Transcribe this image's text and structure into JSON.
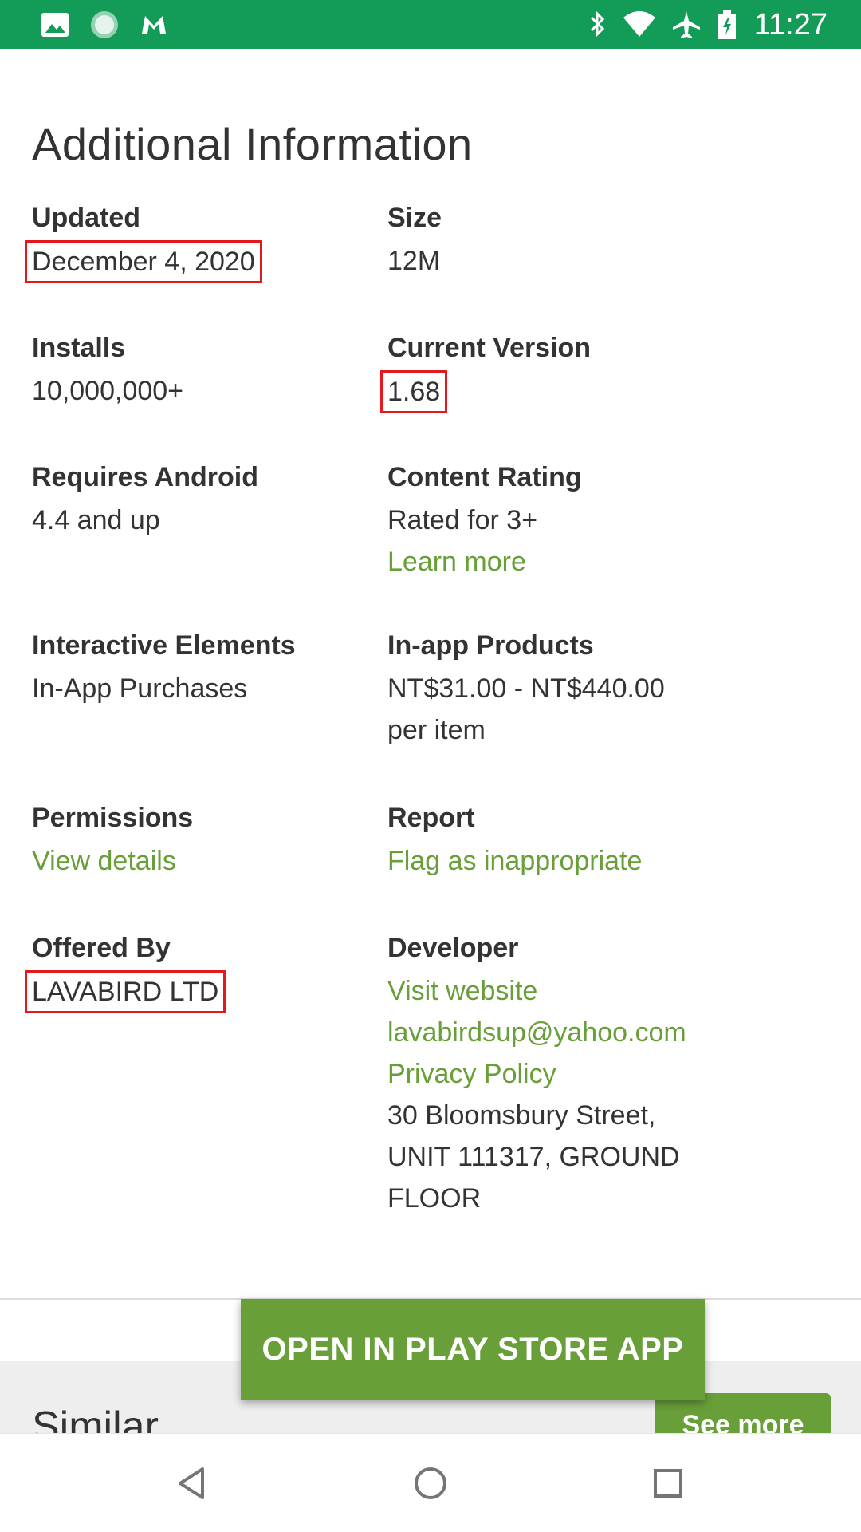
{
  "status_bar": {
    "time": "11:27",
    "left_icons": [
      "image-icon",
      "loading-circle-icon",
      "malwarebytes-icon"
    ],
    "right_icons": [
      "bluetooth-icon",
      "wifi-icon",
      "airplane-icon",
      "battery-charging-icon"
    ],
    "background_color": "#129c58"
  },
  "section": {
    "title": "Additional Information"
  },
  "info": {
    "updated": {
      "label": "Updated",
      "value": "December 4, 2020"
    },
    "size": {
      "label": "Size",
      "value": "12M"
    },
    "installs": {
      "label": "Installs",
      "value": "10,000,000+"
    },
    "current_version": {
      "label": "Current Version",
      "value": "1.68"
    },
    "requires_android": {
      "label": "Requires Android",
      "value": "4.4 and up"
    },
    "content_rating": {
      "label": "Content Rating",
      "value": "Rated for 3+",
      "link": "Learn more"
    },
    "interactive_elements": {
      "label": "Interactive Elements",
      "value": "In-App Purchases"
    },
    "in_app_products": {
      "label": "In-app Products",
      "value_line1": "NT$31.00 - NT$440.00",
      "value_line2": "per item"
    },
    "permissions": {
      "label": "Permissions",
      "link": "View details"
    },
    "report": {
      "label": "Report",
      "link": "Flag as inappropriate"
    },
    "offered_by": {
      "label": "Offered By",
      "value": "LAVABIRD LTD"
    },
    "developer": {
      "label": "Developer",
      "website": "Visit website",
      "email": "lavabirdsup@yahoo.com",
      "privacy": "Privacy Policy",
      "address_line1": "30 Bloomsbury Street,",
      "address_line2": "UNIT 111317, GROUND",
      "address_line3": "FLOOR"
    }
  },
  "similar": {
    "title": "Similar",
    "see_more": "See more"
  },
  "open_button": "OPEN IN PLAY STORE APP",
  "colors": {
    "link": "#689f38",
    "highlight_box": "#e3191e",
    "button": "#689f38"
  },
  "nav_bar": {
    "icons": [
      "back-icon",
      "home-icon",
      "recents-icon"
    ]
  }
}
